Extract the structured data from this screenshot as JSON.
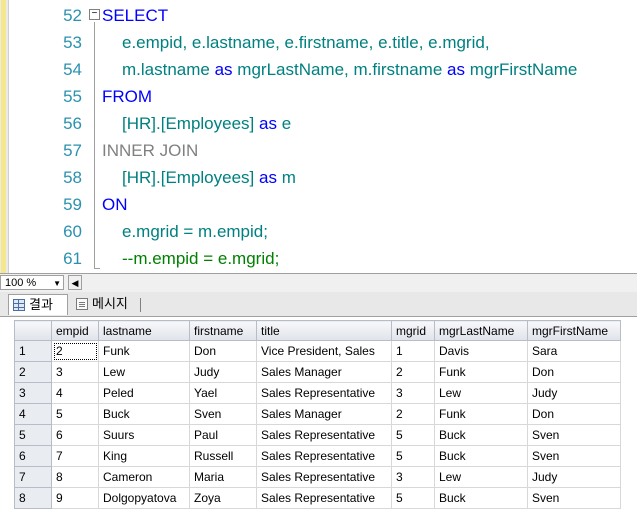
{
  "editor": {
    "lines": [
      {
        "num": "52",
        "parts": [
          {
            "t": "SELECT",
            "c": "kw"
          }
        ]
      },
      {
        "num": "53",
        "parts": [
          {
            "t": "e.empid, e.lastname, e.firstname, e.title, e.mgrid,",
            "c": "id"
          }
        ]
      },
      {
        "num": "54",
        "parts": [
          {
            "t": "m.lastname ",
            "c": "id"
          },
          {
            "t": "as",
            "c": "kw"
          },
          {
            "t": " mgrLastName, m.firstname ",
            "c": "id"
          },
          {
            "t": "as",
            "c": "kw"
          },
          {
            "t": " mgrFirstName",
            "c": "id"
          }
        ]
      },
      {
        "num": "55",
        "parts": [
          {
            "t": "FROM",
            "c": "kw"
          }
        ]
      },
      {
        "num": "56",
        "parts": [
          {
            "t": "[HR].[Employees] ",
            "c": "id"
          },
          {
            "t": "as",
            "c": "kw"
          },
          {
            "t": " e",
            "c": "id"
          }
        ]
      },
      {
        "num": "57",
        "parts": [
          {
            "t": "INNER JOIN",
            "c": "gray"
          }
        ]
      },
      {
        "num": "58",
        "parts": [
          {
            "t": "[HR].[Employees] ",
            "c": "id"
          },
          {
            "t": "as",
            "c": "kw"
          },
          {
            "t": " m",
            "c": "id"
          }
        ]
      },
      {
        "num": "59",
        "parts": [
          {
            "t": "ON",
            "c": "kw"
          }
        ]
      },
      {
        "num": "60",
        "parts": [
          {
            "t": "e.mgrid = m.empid;",
            "c": "id"
          }
        ]
      },
      {
        "num": "61",
        "parts": [
          {
            "t": "--m.empid = e.mgrid;",
            "c": "cm"
          }
        ]
      }
    ]
  },
  "zoom": {
    "value": "100 %"
  },
  "tabs": {
    "results": "결과",
    "messages": "메시지"
  },
  "grid": {
    "columns": [
      "empid",
      "lastname",
      "firstname",
      "title",
      "mgrid",
      "mgrLastName",
      "mgrFirstName"
    ],
    "rows": [
      [
        "2",
        "Funk",
        "Don",
        "Vice President, Sales",
        "1",
        "Davis",
        "Sara"
      ],
      [
        "3",
        "Lew",
        "Judy",
        "Sales Manager",
        "2",
        "Funk",
        "Don"
      ],
      [
        "4",
        "Peled",
        "Yael",
        "Sales Representative",
        "3",
        "Lew",
        "Judy"
      ],
      [
        "5",
        "Buck",
        "Sven",
        "Sales Manager",
        "2",
        "Funk",
        "Don"
      ],
      [
        "6",
        "Suurs",
        "Paul",
        "Sales Representative",
        "5",
        "Buck",
        "Sven"
      ],
      [
        "7",
        "King",
        "Russell",
        "Sales Representative",
        "5",
        "Buck",
        "Sven"
      ],
      [
        "8",
        "Cameron",
        "Maria",
        "Sales Representative",
        "3",
        "Lew",
        "Judy"
      ],
      [
        "9",
        "Dolgopyatova",
        "Zoya",
        "Sales Representative",
        "5",
        "Buck",
        "Sven"
      ]
    ],
    "row_numbers": [
      "1",
      "2",
      "3",
      "4",
      "5",
      "6",
      "7",
      "8"
    ]
  }
}
